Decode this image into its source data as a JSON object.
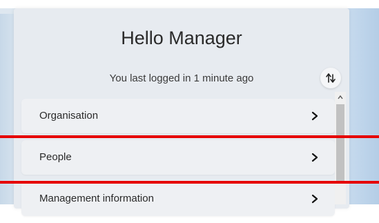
{
  "header": {
    "title": "Hello Manager",
    "subtitle": "You last logged in 1 minute ago"
  },
  "menu": {
    "items": [
      {
        "label": "Organisation",
        "icon": "chevron-right-icon"
      },
      {
        "label": "People",
        "icon": "chevron-right-icon"
      },
      {
        "label": "Management information",
        "icon": "chevron-right-icon"
      }
    ]
  },
  "toolbar": {
    "sort_icon": "sort-arrows-icon"
  },
  "annotations": {
    "highlight_color": "#e60000"
  }
}
